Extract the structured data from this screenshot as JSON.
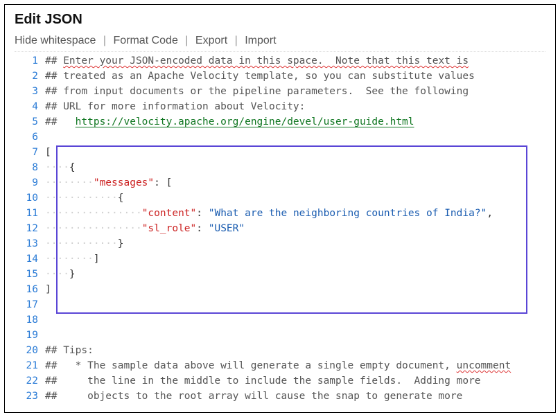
{
  "title": "Edit JSON",
  "toolbar": {
    "hide_whitespace": "Hide whitespace",
    "format_code": "Format Code",
    "export": "Export",
    "import": "Import"
  },
  "lines": {
    "l1_a": "## ",
    "l1_b": "Enter your JSON-encoded data in this space.  Note that this text is",
    "l2_a": "## treated as an Apache Velocity template, so you can substitute values",
    "l3_a": "## from input documents or the pipeline parameters.  See the following",
    "l4_a": "## URL for more information about Velocity:",
    "l5_a": "##   ",
    "l5_url": "https://velocity.apache.org/engine/devel/user-guide.html",
    "l7": "[",
    "l8_ws": "····",
    "l8": "{",
    "l9_ws": "········",
    "l9_key": "\"messages\"",
    "l9_colon": ": ",
    "l9_val": "[",
    "l10_ws": "············",
    "l10": "{",
    "l11_ws": "················",
    "l11_key": "\"content\"",
    "l11_colon": ": ",
    "l11_val": "\"What are the neighboring countries of India?\"",
    "l11_comma": ",",
    "l12_ws": "················",
    "l12_key": "\"sl_role\"",
    "l12_colon": ": ",
    "l12_val": "\"USER\"",
    "l13_ws": "············",
    "l13": "}",
    "l14_ws": "········",
    "l14": "]",
    "l15_ws": "····",
    "l15": "}",
    "l16": "]",
    "l20": "## Tips:",
    "l21_a": "##   * The sample data above will generate a single empty document, ",
    "l21_b": "uncomment",
    "l22_a": "##     the line in the middle to include the sample fields.  Adding more",
    "l23_a": "##     objects to the root array will cause the snap to generate more"
  },
  "line_numbers": [
    "1",
    "2",
    "3",
    "4",
    "5",
    "6",
    "7",
    "8",
    "9",
    "10",
    "11",
    "12",
    "13",
    "14",
    "15",
    "16",
    "17",
    "18",
    "19",
    "20",
    "21",
    "22",
    "23"
  ],
  "colors": {
    "highlight_border": "#5a46d6",
    "line_number": "#2a7bd6",
    "key": "#c22",
    "string": "#1a5cb0",
    "url": "#117722"
  }
}
